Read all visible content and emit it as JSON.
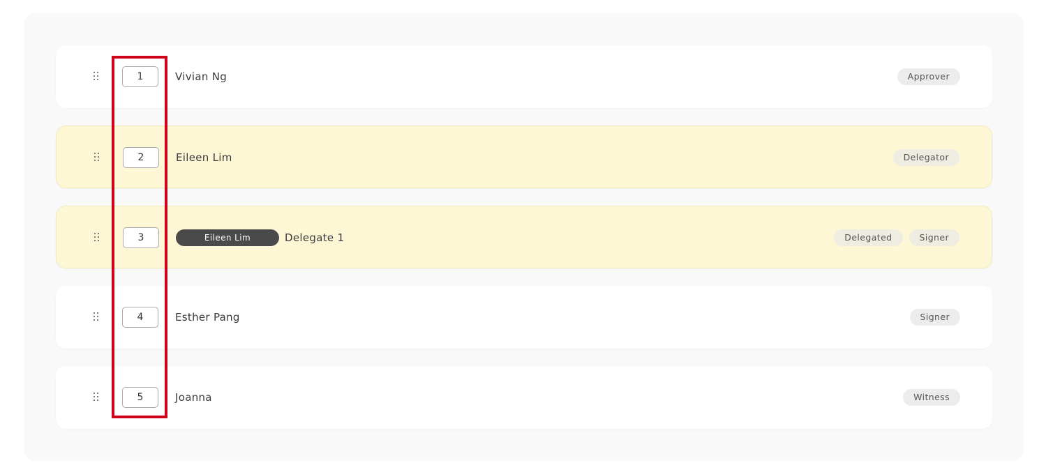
{
  "rows": [
    {
      "order": "1",
      "name": "Vivian Ng",
      "badges": [
        "Approver"
      ],
      "highlighted": false
    },
    {
      "order": "2",
      "name": "Eileen Lim",
      "badges": [
        "Delegator"
      ],
      "highlighted": true
    },
    {
      "order": "3",
      "chip": "Eileen Lim",
      "name": "Delegate 1",
      "badges": [
        "Delegated",
        "Signer"
      ],
      "highlighted": true
    },
    {
      "order": "4",
      "name": "Esther Pang",
      "badges": [
        "Signer"
      ],
      "highlighted": false
    },
    {
      "order": "5",
      "name": "Joanna",
      "badges": [
        "Witness"
      ],
      "highlighted": false
    }
  ],
  "colors": {
    "highlight_row": "#fdf7d5",
    "annotation_box": "#d0021b",
    "chip": "#4a4a4a"
  }
}
